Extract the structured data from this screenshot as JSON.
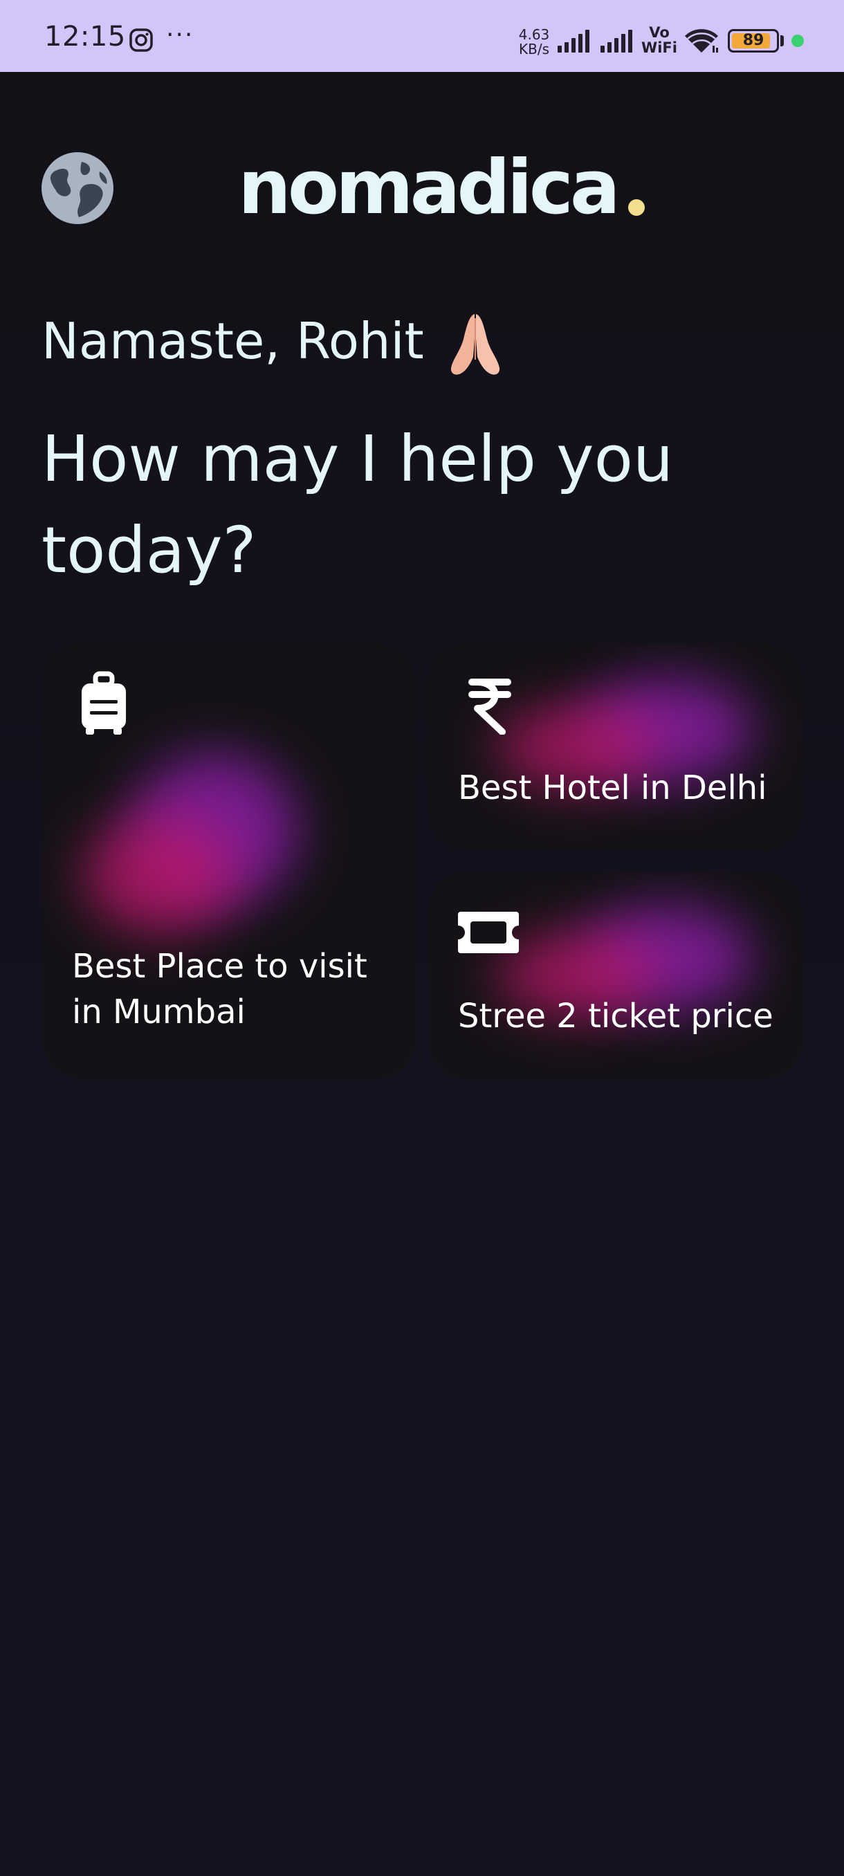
{
  "status_bar": {
    "time": "12:15",
    "instagram_icon": "instagram-icon",
    "more": "···",
    "net_speed_value": "4.63",
    "net_speed_unit": "KB/s",
    "vowifi_line1": "Vo",
    "vowifi_line2": "WiFi",
    "battery": "89",
    "battery_color": "#f3a93a",
    "dot_color": "#3bd16f"
  },
  "header": {
    "globe_icon": "globe-icon",
    "logo_text": "nomadica",
    "logo_dot_color": "#f2de8c"
  },
  "greeting": {
    "text": "Namaste, Rohit",
    "emoji_icon": "folded-hands-icon"
  },
  "headline": "How may I help you today?",
  "cards": [
    {
      "icon": "luggage-icon",
      "label": "Best Place to visit in Mumbai"
    },
    {
      "icon": "rupee-icon",
      "label": "Best Hotel in Delhi"
    },
    {
      "icon": "ticket-icon",
      "label": "Stree 2 ticket price"
    }
  ],
  "colors": {
    "text": "#e4f6f8",
    "glow_pink": "#c0186b",
    "glow_purple": "#8a1ea5"
  }
}
